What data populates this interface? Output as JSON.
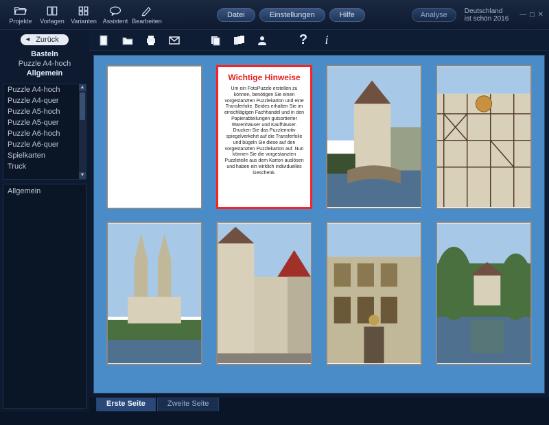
{
  "toolbar": {
    "projekte": "Projekte",
    "vorlagen": "Vorlagen",
    "varianten": "Varianten",
    "assistent": "Assistent",
    "bearbeiten": "Bearbeiten"
  },
  "menu": {
    "datei": "Datei",
    "einstellungen": "Einstellungen",
    "hilfe": "Hilfe"
  },
  "analyse": "Analyse",
  "brand": {
    "line1": "Deutschland",
    "line2": "ist schön 2016"
  },
  "back": "Zurück",
  "crumbs": [
    "Basteln",
    "Puzzle A4-hoch",
    "Allgemein"
  ],
  "formats": [
    "Puzzle A4-hoch",
    "Puzzle A4-quer",
    "Puzzle A5-hoch",
    "Puzzle A5-quer",
    "Puzzle A6-hoch",
    "Puzzle A6-quer",
    "Spielkarten",
    "Truck"
  ],
  "general": "Allgemein",
  "hint": {
    "title": "Wichtige Hinweise",
    "body": "Um ein FotoPuzzle erstellen zu können, benötigen Sie einen vorgestanzten Puzzlekarton und eine Transferfolie. Beides erhalten Sie im einschlägigen Fachhandel und in den Papierabteilungen gutsortierter Warenhäuser und Kaufhäuser. Drucken Sie das Puzzlemotiv spiegelverkehrt auf die Transferfolie und bügeln Sie diese auf den vorgestanzten Puzzlekarton auf. Nun können Sie die vorgestanzten Puzzleteile aus dem Karton auslösen und haben ein wirklich individuelles Geschenk."
  },
  "tabs": {
    "first": "Erste Seite",
    "second": "Zweite Seite"
  },
  "icons": {
    "new": "new-icon",
    "open": "open-icon",
    "print": "print-icon",
    "mail": "mail-icon",
    "copy": "copy-icon",
    "multi": "multi-icon",
    "user": "user-icon",
    "help": "help-icon",
    "info": "info-icon"
  }
}
